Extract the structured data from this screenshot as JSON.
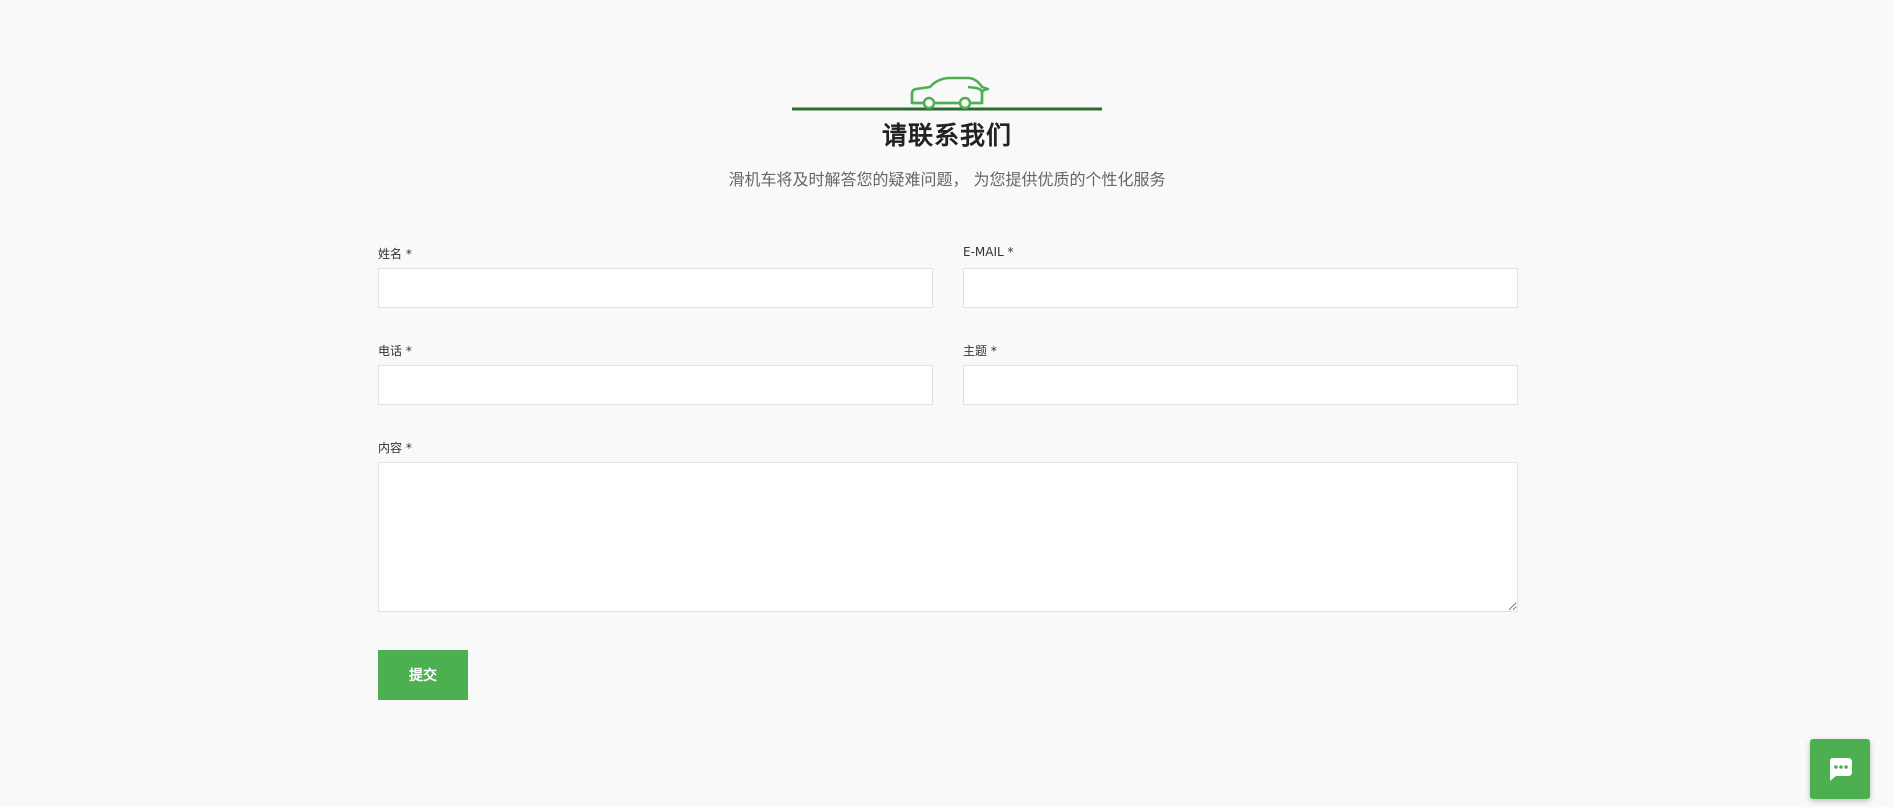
{
  "header": {
    "title": "请联系我们",
    "subtitle": "滑机车将及时解答您的疑难问题， 为您提供优质的个性化服务"
  },
  "form": {
    "name_label": "姓名 *",
    "email_label": "E-MAIL *",
    "phone_label": "电话 *",
    "subject_label": "主题 *",
    "content_label": "内容 *",
    "name_value": "",
    "email_value": "",
    "phone_value": "",
    "subject_value": "",
    "content_value": "",
    "submit_label": "提交"
  },
  "icons": {
    "header_decoration": "car-icon",
    "chat": "chat-bubble-icon"
  },
  "colors": {
    "accent": "#4caf50",
    "divider": "#2e6b33",
    "car_outline": "#4caf50",
    "background": "#f9f9f9"
  }
}
